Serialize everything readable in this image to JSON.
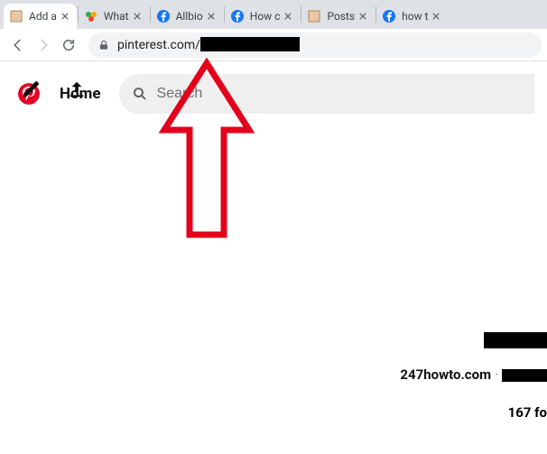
{
  "browser": {
    "tabs": [
      {
        "title": "Add a",
        "icon": "generic"
      },
      {
        "title": "What",
        "icon": "multi"
      },
      {
        "title": "Allbio",
        "icon": "facebook"
      },
      {
        "title": "How c",
        "icon": "facebook"
      },
      {
        "title": "Posts",
        "icon": "generic"
      },
      {
        "title": "how t",
        "icon": "facebook"
      }
    ],
    "url_host": "pinterest.com/"
  },
  "pinterest": {
    "home_label": "Home",
    "search_placeholder": "Search",
    "profile_site": "247howto.com",
    "followers_label": "167 fo"
  }
}
